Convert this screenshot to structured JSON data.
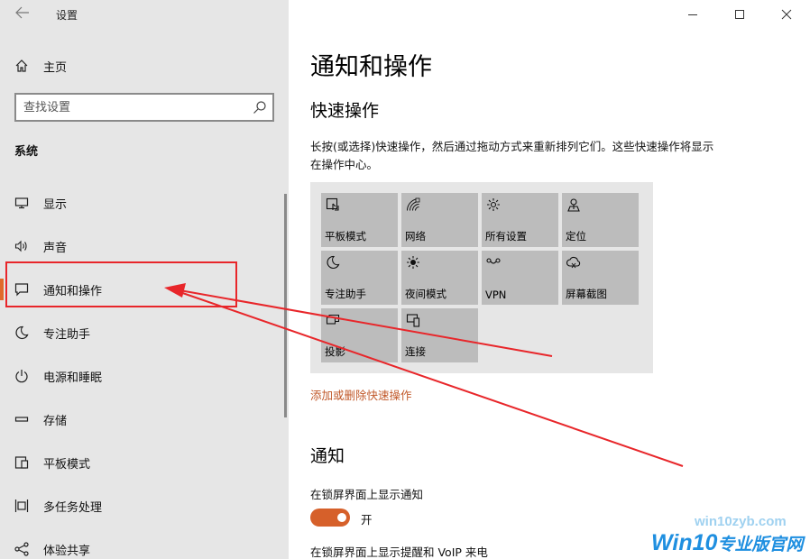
{
  "window": {
    "title": "设置"
  },
  "sidebar": {
    "home_label": "主页",
    "search_placeholder": "查找设置",
    "section_label": "系统",
    "items": [
      {
        "label": "显示",
        "icon": "display-icon"
      },
      {
        "label": "声音",
        "icon": "speaker-icon"
      },
      {
        "label": "通知和操作",
        "icon": "notification-icon",
        "active": true
      },
      {
        "label": "专注助手",
        "icon": "moon-icon"
      },
      {
        "label": "电源和睡眠",
        "icon": "power-icon"
      },
      {
        "label": "存储",
        "icon": "storage-icon"
      },
      {
        "label": "平板模式",
        "icon": "tablet-icon"
      },
      {
        "label": "多任务处理",
        "icon": "multitask-icon"
      },
      {
        "label": "体验共享",
        "icon": "share-icon"
      }
    ]
  },
  "main": {
    "page_title": "通知和操作",
    "quick_actions_title": "快速操作",
    "quick_actions_desc": "长按(或选择)快速操作，然后通过拖动方式来重新排列它们。这些快速操作将显示在操作中心。",
    "tiles": [
      {
        "label": "平板模式",
        "icon": "tablet-mode-icon"
      },
      {
        "label": "网络",
        "icon": "network-icon"
      },
      {
        "label": "所有设置",
        "icon": "gear-icon"
      },
      {
        "label": "定位",
        "icon": "location-icon"
      },
      {
        "label": "专注助手",
        "icon": "moon-icon"
      },
      {
        "label": "夜间模式",
        "icon": "brightness-icon"
      },
      {
        "label": "VPN",
        "icon": "vpn-icon"
      },
      {
        "label": "屏幕截图",
        "icon": "screenshot-icon"
      },
      {
        "label": "投影",
        "icon": "project-icon"
      },
      {
        "label": "连接",
        "icon": "connect-icon"
      }
    ],
    "edit_link": "添加或删除快速操作",
    "notifications_title": "通知",
    "lock_screen_notify_label": "在锁屏界面上显示通知",
    "lock_screen_toggle_state": "开",
    "lock_screen_voip_label": "在锁屏界面上显示提醒和 VoIP 来电"
  },
  "colors": {
    "accent": "#e06a2a",
    "toggle_on": "#d6602a",
    "link": "#c1592a",
    "annotation": "#e8262a"
  },
  "watermark": {
    "url": "win10zyb.com",
    "logo_main": "Win10",
    "logo_sub": "专业版官网"
  }
}
